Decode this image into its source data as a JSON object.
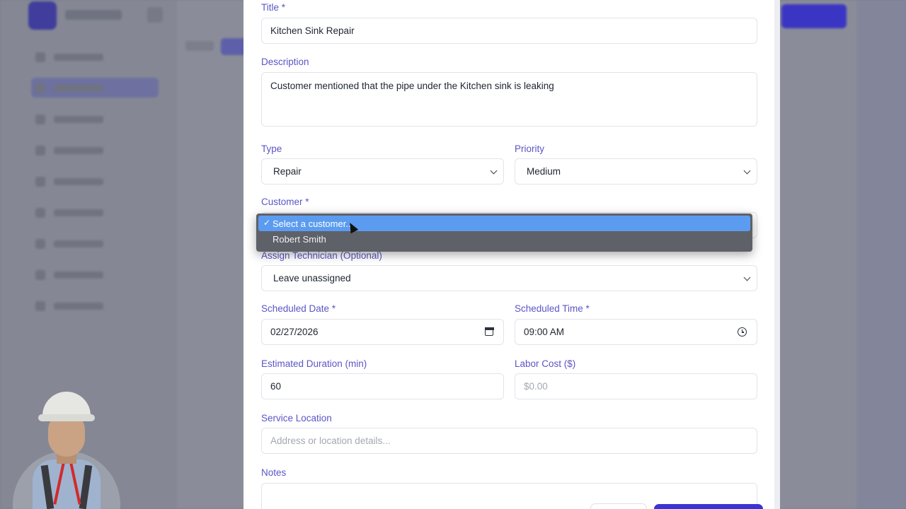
{
  "form": {
    "title_label": "Title *",
    "title_value": "Kitchen Sink Repair",
    "description_label": "Description",
    "description_value": "Customer mentioned that the pipe under the Kitchen sink is leaking",
    "type_label": "Type",
    "type_value": "Repair",
    "priority_label": "Priority",
    "priority_value": "Medium",
    "customer_label": "Customer *",
    "customer_options": [
      {
        "label": "Select a customer...",
        "selected": true
      },
      {
        "label": "Robert Smith",
        "selected": false
      }
    ],
    "technician_label": "Assign Technician (Optional)",
    "technician_value": "Leave unassigned",
    "scheduled_date_label": "Scheduled Date *",
    "scheduled_date_value": "02/27/2026",
    "scheduled_time_label": "Scheduled Time *",
    "scheduled_time_value": "09:00 AM",
    "duration_label": "Estimated Duration (min)",
    "duration_value": "60",
    "labor_cost_label": "Labor Cost ($)",
    "labor_cost_placeholder": "$0.00",
    "service_location_label": "Service Location",
    "service_location_placeholder": "Address or location details...",
    "notes_label": "Notes"
  },
  "icons": {
    "check": "✓"
  },
  "colors": {
    "label": "#5a55c7",
    "primary": "#3b34d2",
    "dropdown_highlight": "#5b9cf0"
  }
}
